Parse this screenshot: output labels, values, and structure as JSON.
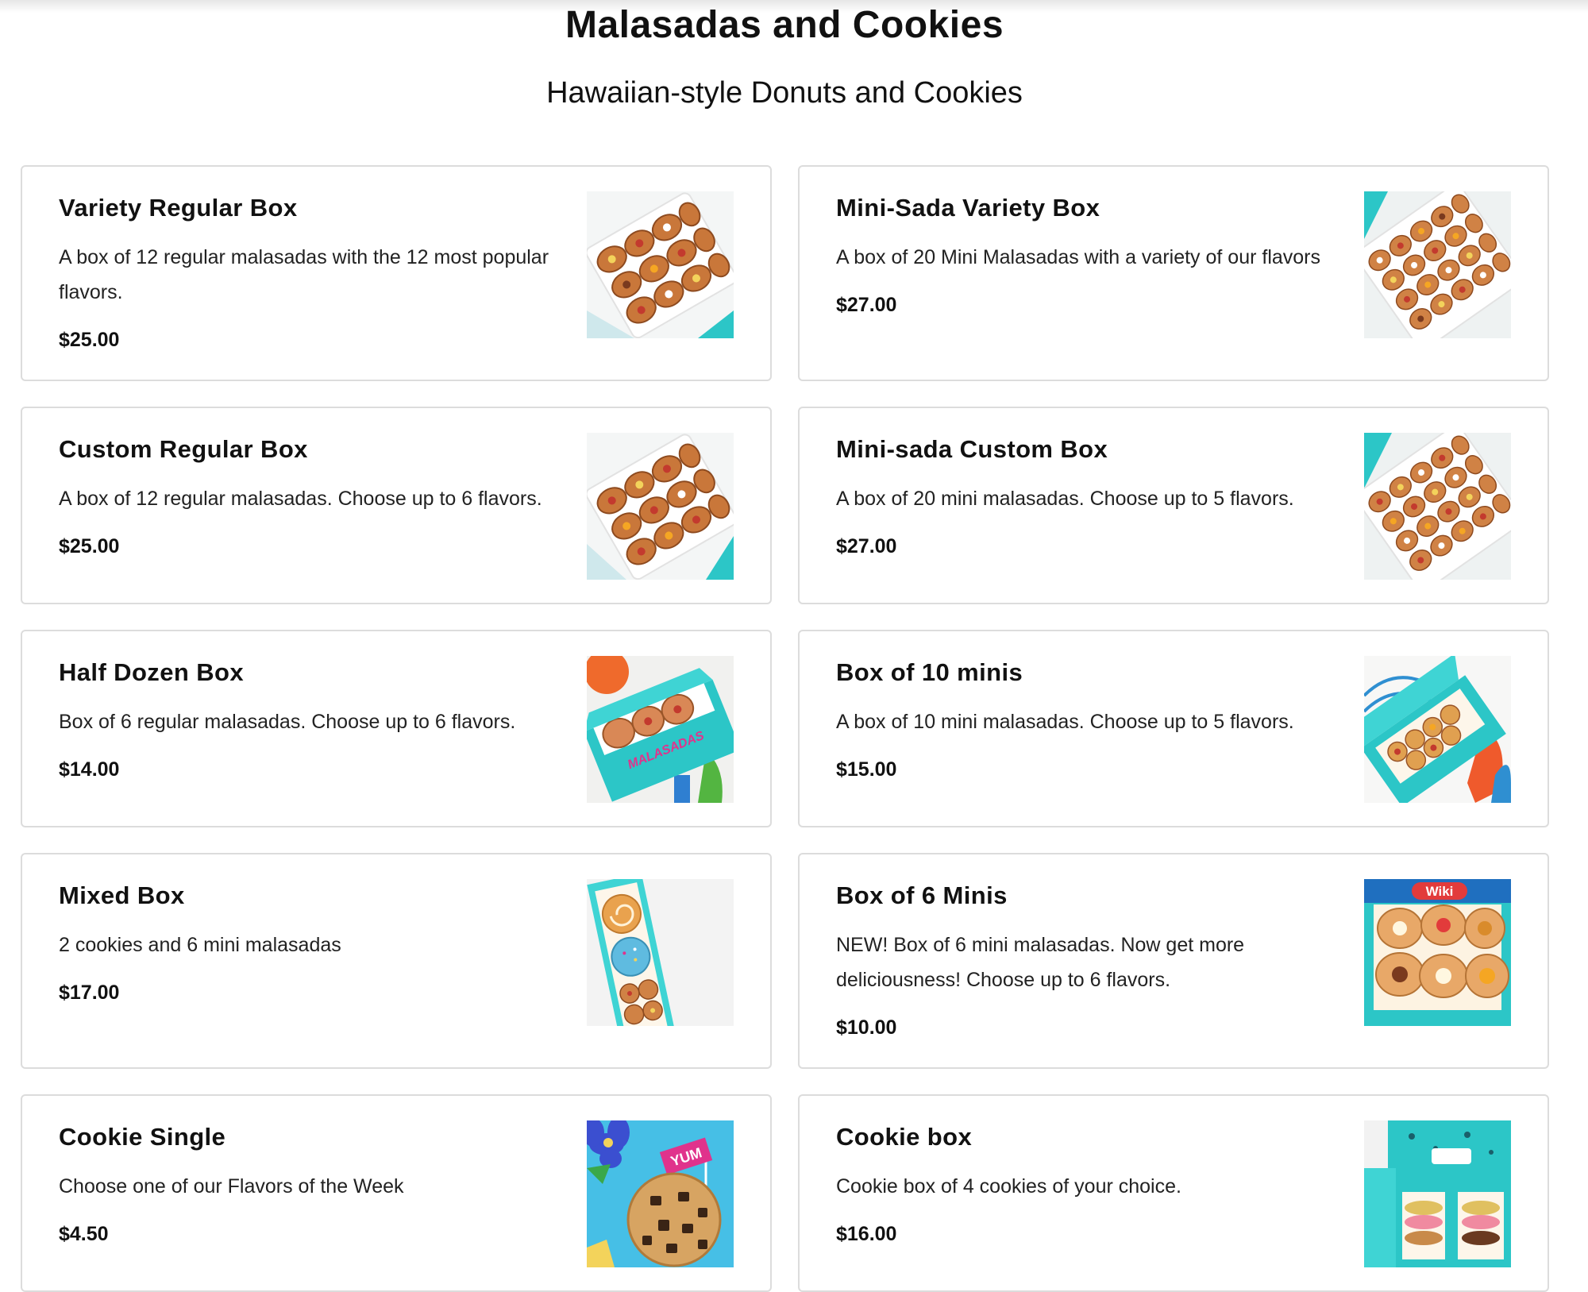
{
  "header": {
    "title": "Malasadas and Cookies",
    "subtitle": "Hawaiian-style Donuts and Cookies"
  },
  "items": [
    {
      "name": "Variety Regular Box",
      "description": "A box of 12 regular malasadas with the 12 most popular flavors.",
      "price": "$25.00",
      "image_icon": "malasada-box-image"
    },
    {
      "name": "Mini-Sada Variety Box",
      "description": "A box of 20 Mini Malasadas with a variety of our flavors",
      "price": "$27.00",
      "image_icon": "mini-malasada-box-image"
    },
    {
      "name": "Custom Regular Box",
      "description": "A box of 12 regular malasadas. Choose up to 6 flavors.",
      "price": "$25.00",
      "image_icon": "malasada-box-image"
    },
    {
      "name": "Mini-sada Custom Box",
      "description": "A box of 20 mini malasadas. Choose up to 5 flavors.",
      "price": "$27.00",
      "image_icon": "mini-malasada-box-image"
    },
    {
      "name": "Half Dozen Box",
      "description": "Box of 6 regular malasadas. Choose up to 6 flavors.",
      "price": "$14.00",
      "image_icon": "teal-box-image"
    },
    {
      "name": "Box of 10 minis",
      "description": "A box of 10 mini malasadas. Choose up to 5 flavors.",
      "price": "$15.00",
      "image_icon": "open-teal-box-image"
    },
    {
      "name": "Mixed Box",
      "description": "2 cookies and 6 mini malasadas",
      "price": "$17.00",
      "image_icon": "mixed-box-image"
    },
    {
      "name": "Box of 6 Minis",
      "description": "NEW! Box of 6 mini malasadas. Now get more deliciousness! Choose up to 6 flavors.",
      "price": "$10.00",
      "image_icon": "wiki-box-image"
    },
    {
      "name": "Cookie Single",
      "description": "Choose one of our Flavors of the Week",
      "price": "$4.50",
      "image_icon": "cookie-image"
    },
    {
      "name": "Cookie box",
      "description": "Cookie box of 4 cookies of your choice.",
      "price": "$16.00",
      "image_icon": "cookie-box-image"
    }
  ],
  "image_text": {
    "half_dozen_box_print": "MALASADAS",
    "mini6_box_logo": "Wiki",
    "cookie_flag": "YUM"
  },
  "colors": {
    "accent_teal": "#2cc6c7",
    "card_border": "#dcdcdc",
    "text": "#111111"
  }
}
